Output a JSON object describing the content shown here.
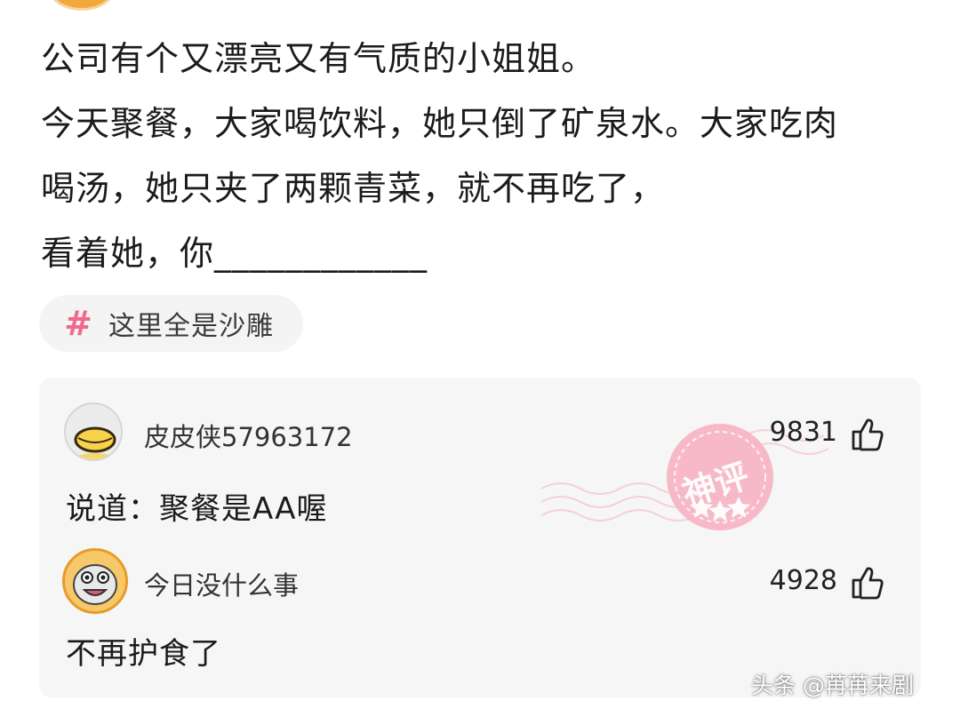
{
  "post": {
    "lines": [
      "公司有个又漂亮又有气质的小姐姐。",
      "今天聚餐，大家喝饮料，她只倒了矿泉水。大家吃肉",
      "喝汤，她只夹了两颗青菜，就不再吃了，",
      "看着她，你____________"
    ]
  },
  "topic": {
    "icon": "hashtag-icon",
    "label": "这里全是沙雕"
  },
  "comments": [
    {
      "username": "皮皮侠57963172",
      "likes": "9831",
      "text": "说道：聚餐是AA喔",
      "avatar": "duck-avatar",
      "badge": "神评"
    },
    {
      "username": "今日没什么事",
      "likes": "4928",
      "text": "不再护食了",
      "avatar": "cartoon-avatar"
    }
  ],
  "watermark": "头条 @苒苒来剧",
  "colors": {
    "accent_pink": "#f06a8d",
    "stamp_pink": "#f4a6b8",
    "card_bg": "#f6f6f6"
  }
}
